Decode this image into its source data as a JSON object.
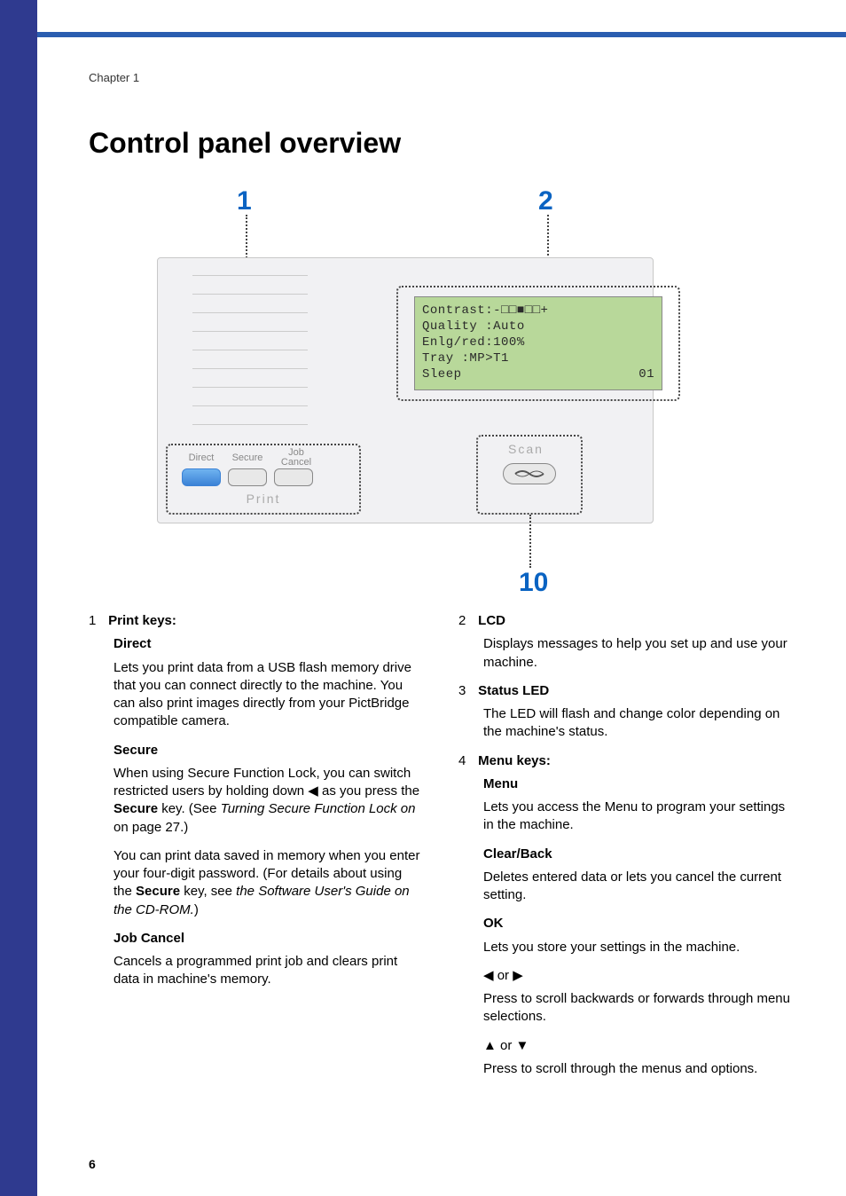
{
  "chapter": "Chapter 1",
  "title": "Control panel overview",
  "page_number": "6",
  "figure": {
    "callouts": {
      "c1": "1",
      "c2": "2",
      "c10": "10"
    },
    "lcd_lines": {
      "l1": "Contrast:-□□■□□+",
      "l2": "Quality :Auto",
      "l3": "Enlg/red:100%",
      "l4": "Tray    :MP>T1",
      "l5": "Sleep",
      "l5num": "01"
    },
    "print_area": {
      "direct": "Direct",
      "secure": "Secure",
      "job_cancel_l1": "Job",
      "job_cancel_l2": "Cancel",
      "print": "Print"
    },
    "scan_area": {
      "scan": "Scan"
    }
  },
  "left_column": {
    "n1": "1",
    "h1": "Print keys:",
    "direct_h": "Direct",
    "direct_p": "Lets you print data from a USB flash memory drive that you can connect directly to the machine. You can also print images directly from your PictBridge compatible camera.",
    "secure_h": "Secure",
    "secure_p1a": "When using Secure Function Lock, you can switch restricted users by holding down ",
    "secure_p1_arrow": "◀",
    "secure_p1b": " as you press the ",
    "secure_p1_bold": "Secure",
    "secure_p1c": " key. (See ",
    "secure_p1_italic": "Turning Secure Function Lock on",
    "secure_p1d": " on page 27.)",
    "secure_p2a": "You can print data saved in memory when you enter your four-digit password. (For details about using the ",
    "secure_p2_bold": "Secure",
    "secure_p2b": " key, see ",
    "secure_p2_italic": "the Software User's Guide on the CD-ROM.",
    "secure_p2c": ")",
    "jobcancel_h": "Job Cancel",
    "jobcancel_p": "Cancels a programmed print job and clears print data in machine's memory."
  },
  "right_column": {
    "n2": "2",
    "h2": "LCD",
    "p2": "Displays messages to help you set up and use your machine.",
    "n3": "3",
    "h3": "Status LED",
    "p3": "The LED will flash and change color depending on the machine's status.",
    "n4": "4",
    "h4": "Menu keys:",
    "menu_h": "Menu",
    "menu_p": "Lets you access the Menu to program your settings in the machine.",
    "clear_h": "Clear/Back",
    "clear_p": "Deletes entered data or lets you cancel the current setting.",
    "ok_h": "OK",
    "ok_p": "Lets you store your settings in the machine.",
    "lr_h": "◀ or ▶",
    "lr_p": "Press to scroll backwards or forwards through menu selections.",
    "ud_h": "▲ or ▼",
    "ud_p": "Press to scroll through the menus and options."
  }
}
